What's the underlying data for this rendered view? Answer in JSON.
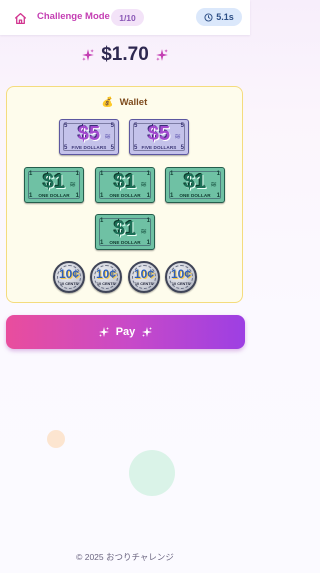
{
  "header": {
    "home_icon": "home-icon",
    "mode_title": "Challenge Mode",
    "round_label": "1/10",
    "timer_icon": "clock-icon",
    "timer_value": "5.1s"
  },
  "target": {
    "amount": "$1.70",
    "decoration_icon": "sparkle-icon"
  },
  "wallet": {
    "icon": "money-bag-icon",
    "emoji": "💰",
    "title": "Wallet",
    "five_dollar_bills": [
      {
        "value_label": "$5",
        "corner": "5",
        "text": "FIVE DOLLARS"
      },
      {
        "value_label": "$5",
        "corner": "5",
        "text": "FIVE DOLLARS"
      }
    ],
    "one_dollar_bills": [
      {
        "value_label": "$1",
        "corner": "1",
        "text": "ONE DOLLAR"
      },
      {
        "value_label": "$1",
        "corner": "1",
        "text": "ONE DOLLAR"
      },
      {
        "value_label": "$1",
        "corner": "1",
        "text": "ONE DOLLAR"
      },
      {
        "value_label": "$1",
        "corner": "1",
        "text": "ONE DOLLAR"
      }
    ],
    "ten_cent_coins": [
      {
        "value_label": "10¢",
        "text": "10 CENTS"
      },
      {
        "value_label": "10¢",
        "text": "10 CENTS"
      },
      {
        "value_label": "10¢",
        "text": "10 CENTS"
      },
      {
        "value_label": "10¢",
        "text": "10 CENTS"
      }
    ]
  },
  "pay_button": {
    "label": "Pay",
    "icon": "sparkle-icon"
  },
  "footer": {
    "copyright": "© 2025 おつりチャレンジ"
  },
  "colors": {
    "brand_pink": "#e94d9d",
    "brand_purple": "#9d3fe3",
    "mode_title": "#c43fb3",
    "wallet_bg": "#fefcec",
    "wallet_border": "#f4dc7e",
    "timer_bg": "#dbe8fb"
  }
}
